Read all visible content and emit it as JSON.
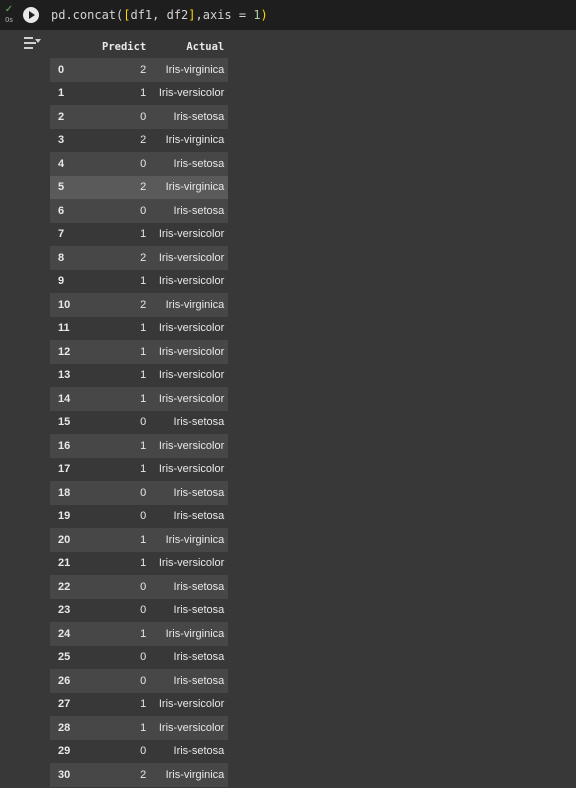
{
  "cell": {
    "status_check": "✓",
    "status_time": "0s",
    "code": {
      "p1": "pd.concat(",
      "p2": "[",
      "p3": "df1, df2",
      "p4": "]",
      "p5": ",axis = ",
      "p6": "1",
      "p7": ")"
    }
  },
  "table": {
    "columns": [
      "",
      "Predict",
      "Actual"
    ],
    "rows": [
      {
        "idx": "0",
        "pred": "2",
        "act": "Iris-virginica"
      },
      {
        "idx": "1",
        "pred": "1",
        "act": "Iris-versicolor"
      },
      {
        "idx": "2",
        "pred": "0",
        "act": "Iris-setosa"
      },
      {
        "idx": "3",
        "pred": "2",
        "act": "Iris-virginica"
      },
      {
        "idx": "4",
        "pred": "0",
        "act": "Iris-setosa"
      },
      {
        "idx": "5",
        "pred": "2",
        "act": "Iris-virginica"
      },
      {
        "idx": "6",
        "pred": "0",
        "act": "Iris-setosa"
      },
      {
        "idx": "7",
        "pred": "1",
        "act": "Iris-versicolor"
      },
      {
        "idx": "8",
        "pred": "2",
        "act": "Iris-versicolor"
      },
      {
        "idx": "9",
        "pred": "1",
        "act": "Iris-versicolor"
      },
      {
        "idx": "10",
        "pred": "2",
        "act": "Iris-virginica"
      },
      {
        "idx": "11",
        "pred": "1",
        "act": "Iris-versicolor"
      },
      {
        "idx": "12",
        "pred": "1",
        "act": "Iris-versicolor"
      },
      {
        "idx": "13",
        "pred": "1",
        "act": "Iris-versicolor"
      },
      {
        "idx": "14",
        "pred": "1",
        "act": "Iris-versicolor"
      },
      {
        "idx": "15",
        "pred": "0",
        "act": "Iris-setosa"
      },
      {
        "idx": "16",
        "pred": "1",
        "act": "Iris-versicolor"
      },
      {
        "idx": "17",
        "pred": "1",
        "act": "Iris-versicolor"
      },
      {
        "idx": "18",
        "pred": "0",
        "act": "Iris-setosa"
      },
      {
        "idx": "19",
        "pred": "0",
        "act": "Iris-setosa"
      },
      {
        "idx": "20",
        "pred": "1",
        "act": "Iris-virginica"
      },
      {
        "idx": "21",
        "pred": "1",
        "act": "Iris-versicolor"
      },
      {
        "idx": "22",
        "pred": "0",
        "act": "Iris-setosa"
      },
      {
        "idx": "23",
        "pred": "0",
        "act": "Iris-setosa"
      },
      {
        "idx": "24",
        "pred": "1",
        "act": "Iris-virginica"
      },
      {
        "idx": "25",
        "pred": "0",
        "act": "Iris-setosa"
      },
      {
        "idx": "26",
        "pred": "0",
        "act": "Iris-setosa"
      },
      {
        "idx": "27",
        "pred": "1",
        "act": "Iris-versicolor"
      },
      {
        "idx": "28",
        "pred": "1",
        "act": "Iris-versicolor"
      },
      {
        "idx": "29",
        "pred": "0",
        "act": "Iris-setosa"
      },
      {
        "idx": "30",
        "pred": "2",
        "act": "Iris-virginica"
      }
    ]
  }
}
